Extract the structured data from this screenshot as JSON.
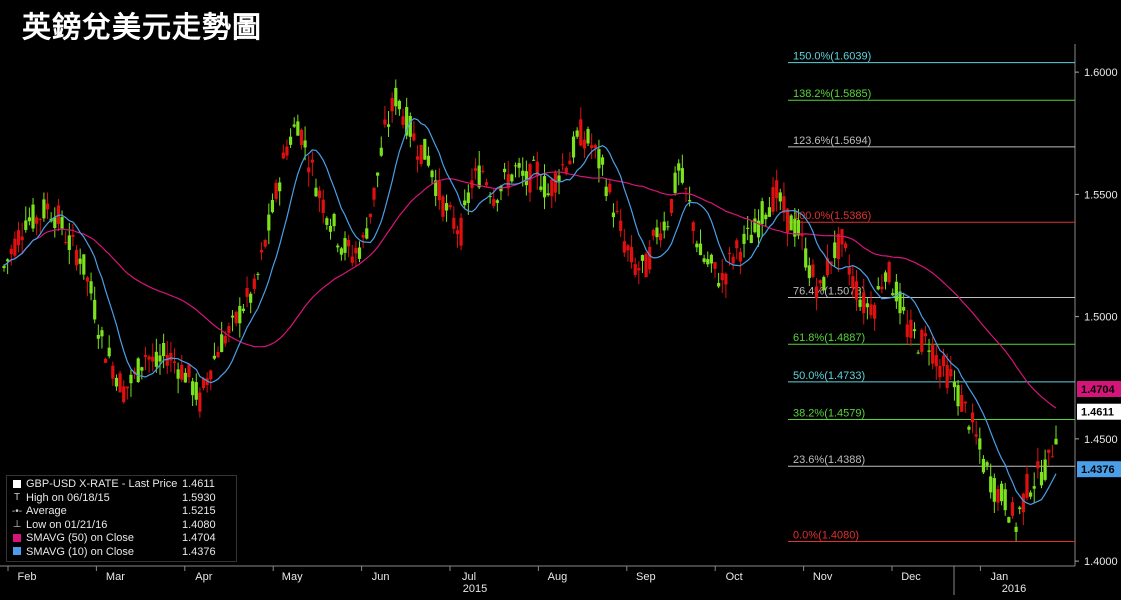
{
  "title": "英鎊兌美元走勢圖",
  "colors": {
    "up": "#7be21c",
    "down": "#e01010",
    "sma50": "#d6157a",
    "sma10": "#4a9fe8",
    "fib_teal": "#5fd3dd",
    "fib_green": "#57d43b",
    "fib_grey": "#bdbdbd",
    "fib_red": "#e03030"
  },
  "legend": {
    "items": [
      {
        "icon": "white-square-icon",
        "label": "GBP-USD X-RATE - Last Price",
        "value": "1.4611"
      },
      {
        "icon": "high-marker-icon",
        "label": "High on 06/18/15",
        "value": "1.5930"
      },
      {
        "icon": "average-marker-icon",
        "label": "Average",
        "value": "1.5215"
      },
      {
        "icon": "low-marker-icon",
        "label": "Low on 01/21/16",
        "value": "1.4080"
      },
      {
        "icon": "magenta-square-icon",
        "label": "SMAVG (50) on Close",
        "value": "1.4704"
      },
      {
        "icon": "blue-square-icon",
        "label": "SMAVG (10) on Close",
        "value": "1.4376"
      }
    ]
  },
  "chart_data": {
    "type": "candlestick",
    "y_range": [
      1.398,
      1.6115
    ],
    "y_ticks": [
      "1.6000",
      "1.5500",
      "1.5000",
      "1.4500",
      "1.4000"
    ],
    "x_ticks": [
      "Feb",
      "Mar",
      "Apr",
      "May",
      "Jun",
      "Jul",
      "Aug",
      "Sep",
      "Oct",
      "Nov",
      "Dec",
      "Jan"
    ],
    "x_year_labels": [
      "2015",
      "2016"
    ],
    "fib_levels": [
      {
        "label": "150.0%(1.6039)",
        "value": 1.6039,
        "color": "teal"
      },
      {
        "label": "138.2%(1.5885)",
        "value": 1.5885,
        "color": "green"
      },
      {
        "label": "123.6%(1.5694)",
        "value": 1.5694,
        "color": "grey"
      },
      {
        "label": "100.0%(1.5386)",
        "value": 1.5386,
        "color": "red"
      },
      {
        "label": "76.4%(1.5078)",
        "value": 1.5078,
        "color": "grey"
      },
      {
        "label": "61.8%(1.4887)",
        "value": 1.4887,
        "color": "green"
      },
      {
        "label": "50.0%(1.4733)",
        "value": 1.4733,
        "color": "teal"
      },
      {
        "label": "38.2%(1.4579)",
        "value": 1.4579,
        "color": "green"
      },
      {
        "label": "23.6%(1.4388)",
        "value": 1.4388,
        "color": "grey"
      },
      {
        "label": "0.0%(1.4080)",
        "value": 1.408,
        "color": "red"
      }
    ],
    "price_tags": [
      {
        "label": "1.4704",
        "value": 1.4704,
        "series": "SMAVG (50) on Close"
      },
      {
        "label": "1.4611",
        "value": 1.4611,
        "series": "Last Price"
      },
      {
        "label": "1.4376",
        "value": 1.4376,
        "series": "SMAVG (10) on Close"
      }
    ],
    "close_path": [
      [
        "Feb",
        1.52
      ],
      [
        "Feb",
        1.53
      ],
      [
        "Feb",
        1.54
      ],
      [
        "Feb",
        1.54
      ],
      [
        "Feb",
        1.545
      ],
      [
        "Feb",
        1.54
      ],
      [
        "Feb",
        1.53
      ],
      [
        "Feb",
        1.525
      ],
      [
        "Mar",
        1.51
      ],
      [
        "Mar",
        1.49
      ],
      [
        "Mar",
        1.48
      ],
      [
        "Mar",
        1.47
      ],
      [
        "Mar",
        1.475
      ],
      [
        "Mar",
        1.485
      ],
      [
        "Mar",
        1.48
      ],
      [
        "Mar",
        1.485
      ],
      [
        "Apr",
        1.48
      ],
      [
        "Apr",
        1.475
      ],
      [
        "Apr",
        1.465
      ],
      [
        "Apr",
        1.48
      ],
      [
        "Apr",
        1.49
      ],
      [
        "Apr",
        1.495
      ],
      [
        "Apr",
        1.505
      ],
      [
        "Apr",
        1.51
      ],
      [
        "May",
        1.53
      ],
      [
        "May",
        1.55
      ],
      [
        "May",
        1.57
      ],
      [
        "May",
        1.58
      ],
      [
        "May",
        1.565
      ],
      [
        "May",
        1.55
      ],
      [
        "May",
        1.54
      ],
      [
        "May",
        1.53
      ],
      [
        "Jun",
        1.525
      ],
      [
        "Jun",
        1.53
      ],
      [
        "Jun",
        1.55
      ],
      [
        "Jun",
        1.575
      ],
      [
        "Jun",
        1.59
      ],
      [
        "Jun",
        1.58
      ],
      [
        "Jun",
        1.57
      ],
      [
        "Jun",
        1.565
      ],
      [
        "Jul",
        1.55
      ],
      [
        "Jul",
        1.54
      ],
      [
        "Jul",
        1.535
      ],
      [
        "Jul",
        1.555
      ],
      [
        "Jul",
        1.56
      ],
      [
        "Jul",
        1.55
      ],
      [
        "Jul",
        1.555
      ],
      [
        "Jul",
        1.56
      ],
      [
        "Aug",
        1.555
      ],
      [
        "Aug",
        1.56
      ],
      [
        "Aug",
        1.55
      ],
      [
        "Aug",
        1.56
      ],
      [
        "Aug",
        1.565
      ],
      [
        "Aug",
        1.575
      ],
      [
        "Aug",
        1.57
      ],
      [
        "Aug",
        1.56
      ],
      [
        "Sep",
        1.545
      ],
      [
        "Sep",
        1.53
      ],
      [
        "Sep",
        1.52
      ],
      [
        "Sep",
        1.52
      ],
      [
        "Sep",
        1.535
      ],
      [
        "Sep",
        1.54
      ],
      [
        "Sep",
        1.56
      ],
      [
        "Sep",
        1.545
      ],
      [
        "Oct",
        1.525
      ],
      [
        "Oct",
        1.52
      ],
      [
        "Oct",
        1.515
      ],
      [
        "Oct",
        1.525
      ],
      [
        "Oct",
        1.53
      ],
      [
        "Oct",
        1.535
      ],
      [
        "Oct",
        1.545
      ],
      [
        "Oct",
        1.55
      ],
      [
        "Nov",
        1.54
      ],
      [
        "Nov",
        1.535
      ],
      [
        "Nov",
        1.52
      ],
      [
        "Nov",
        1.51
      ],
      [
        "Nov",
        1.525
      ],
      [
        "Nov",
        1.53
      ],
      [
        "Nov",
        1.515
      ],
      [
        "Nov",
        1.505
      ],
      [
        "Dec",
        1.505
      ],
      [
        "Dec",
        1.52
      ],
      [
        "Dec",
        1.51
      ],
      [
        "Dec",
        1.495
      ],
      [
        "Dec",
        1.49
      ],
      [
        "Dec",
        1.49
      ],
      [
        "Dec",
        1.48
      ],
      [
        "Dec",
        1.475
      ],
      [
        "Jan",
        1.465
      ],
      [
        "Jan",
        1.455
      ],
      [
        "Jan",
        1.44
      ],
      [
        "Jan",
        1.43
      ],
      [
        "Jan",
        1.425
      ],
      [
        "Jan",
        1.415
      ],
      [
        "Jan",
        1.43
      ],
      [
        "Jan",
        1.435
      ],
      [
        "Jan",
        1.44
      ],
      [
        "Jan",
        1.46
      ]
    ]
  }
}
